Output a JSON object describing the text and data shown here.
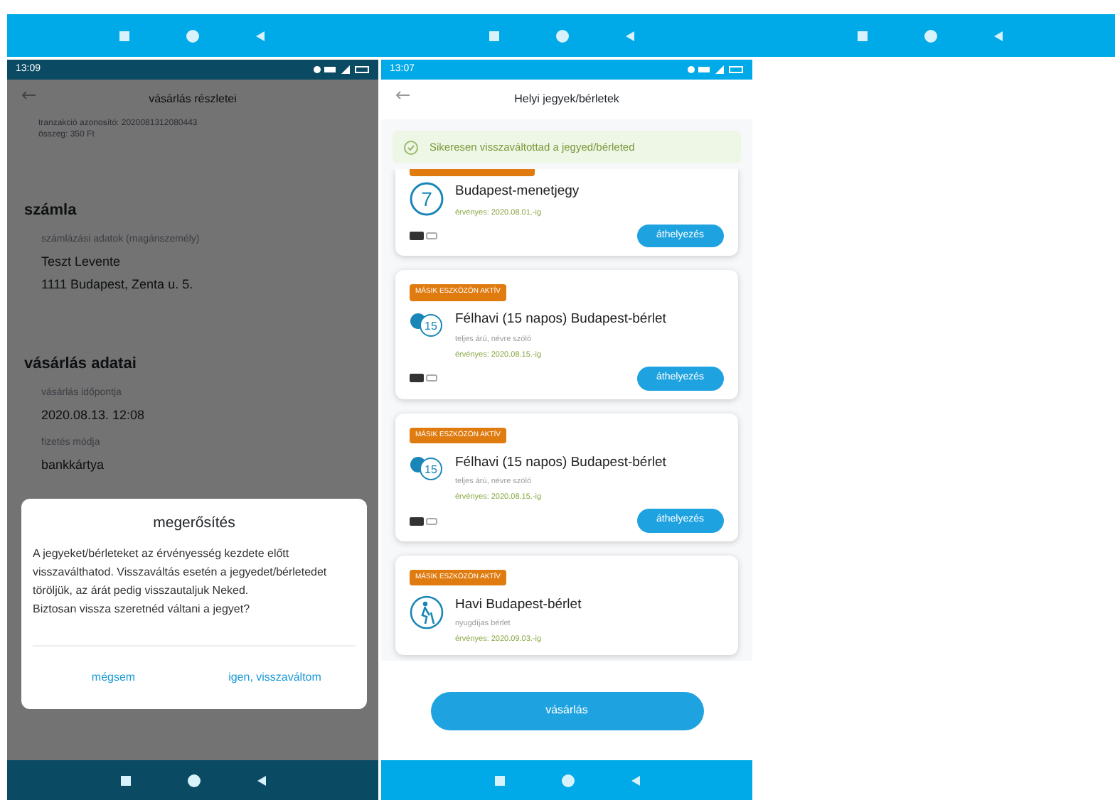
{
  "left_phone": {
    "status_time": "13:09",
    "title": "vásárlás részletei",
    "header_lines": [
      "tranzakció azonosító: 2020081312080443",
      "összeg: 350 Ft"
    ],
    "sections": [
      {
        "heading": "számla",
        "fields": [
          {
            "label": "számlázási adatok (magánszemély)",
            "lines": [
              "Teszt Levente",
              "1111 Budapest, Zenta u. 5."
            ]
          }
        ]
      },
      {
        "heading": "vásárlás adatai",
        "fields": [
          {
            "label": "vásárlás időpontja",
            "lines": [
              "2020.08.13. 12:08"
            ]
          },
          {
            "label": "fizetés módja",
            "lines": [
              "bankkártya"
            ]
          }
        ]
      }
    ]
  },
  "dialog": {
    "title": "megerősítés",
    "paragraphs": [
      "A jegyeket/bérleteket az érvényesség kezdete előtt visszaválthatod. Visszaváltás esetén a jegyedet/bérletedet töröljük, az árát pedig visszautaljuk Neked.",
      "Biztosan vissza szeretnéd váltani a jegyet?"
    ],
    "buttons": [
      "mégsem",
      "igen, visszaváltom"
    ]
  },
  "middle_phone": {
    "status_time": "13:07",
    "title": "Helyi jegyek/bérletek",
    "banner": "Sikeresen visszaváltottad a jegyed/bérleted",
    "tickets": [
      {
        "kind": "single",
        "tag_hidden": true,
        "icon_text": "7",
        "name": "Budapest-menetjegy",
        "validity": "érvényes: 2020.08.01.-ig",
        "button": "áthelyezés"
      },
      {
        "kind": "pass",
        "tag": "MÁSIK ESZKÖZÖN AKTÍV",
        "icon_text": "15",
        "name": "Félhavi (15 napos) Budapest-bérlet",
        "subtitle": "teljes árú, névre szóló",
        "validity": "érvényes: 2020.08.15.-ig",
        "button": "áthelyezés"
      },
      {
        "kind": "pass",
        "tag": "MÁSIK ESZKÖZÖN AKTÍV",
        "icon_text": "15",
        "name": "Félhavi (15 napos) Budapest-bérlet",
        "subtitle": "teljes árú, névre szóló",
        "validity": "érvényes: 2020.08.15.-ig",
        "button": "áthelyezés"
      },
      {
        "kind": "senior",
        "tag": "MÁSIK ESZKÖZÖN AKTÍV",
        "name": "Havi Budapest-bérlet",
        "subtitle": "nyugdíjas bérlet",
        "validity": "érvényes: 2020.09.03.-ig"
      }
    ],
    "bottom_button": "vásárlás"
  }
}
